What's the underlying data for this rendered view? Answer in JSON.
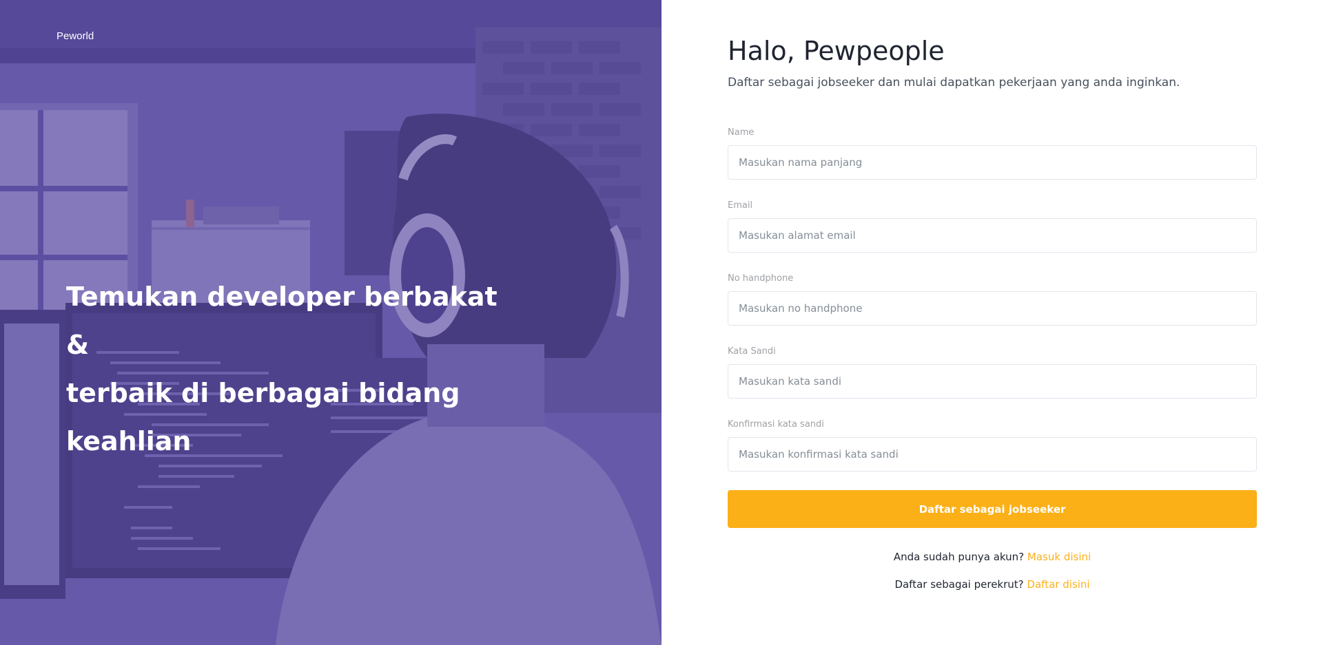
{
  "brand": {
    "name": "Peworld"
  },
  "hero": {
    "headline_lines": [
      "Temukan developer berbakat &",
      "terbaik di berbagai bidang",
      "keahlian"
    ],
    "image": "developer-with-headphones-photo",
    "overlay_color": "#5e50a1"
  },
  "form": {
    "greeting": "Halo, Pewpeople",
    "subtitle": "Daftar sebagai jobseeker dan mulai dapatkan pekerjaan yang anda inginkan.",
    "fields": [
      {
        "label": "Name",
        "placeholder": "Masukan nama panjang",
        "value": ""
      },
      {
        "label": "Email",
        "placeholder": "Masukan alamat email",
        "value": ""
      },
      {
        "label": "No handphone",
        "placeholder": "Masukan no handphone",
        "value": ""
      },
      {
        "label": "Kata Sandi",
        "placeholder": "Masukan kata sandi",
        "value": ""
      },
      {
        "label": "Konfirmasi kata sandi",
        "placeholder": "Masukan konfirmasi kata sandi",
        "value": ""
      }
    ],
    "submit_label": "Daftar sebagai jobseeker",
    "login_prompt": "Anda sudah punya akun?",
    "login_link": "Masuk disini",
    "recruiter_prompt": "Daftar sebagai perekrut?",
    "recruiter_link": "Daftar disini"
  },
  "colors": {
    "accent": "#fbb017",
    "primary": "#5e50a1",
    "text": "#1f2430",
    "muted": "#9ea0a5",
    "input_border": "#e2e5ed"
  }
}
